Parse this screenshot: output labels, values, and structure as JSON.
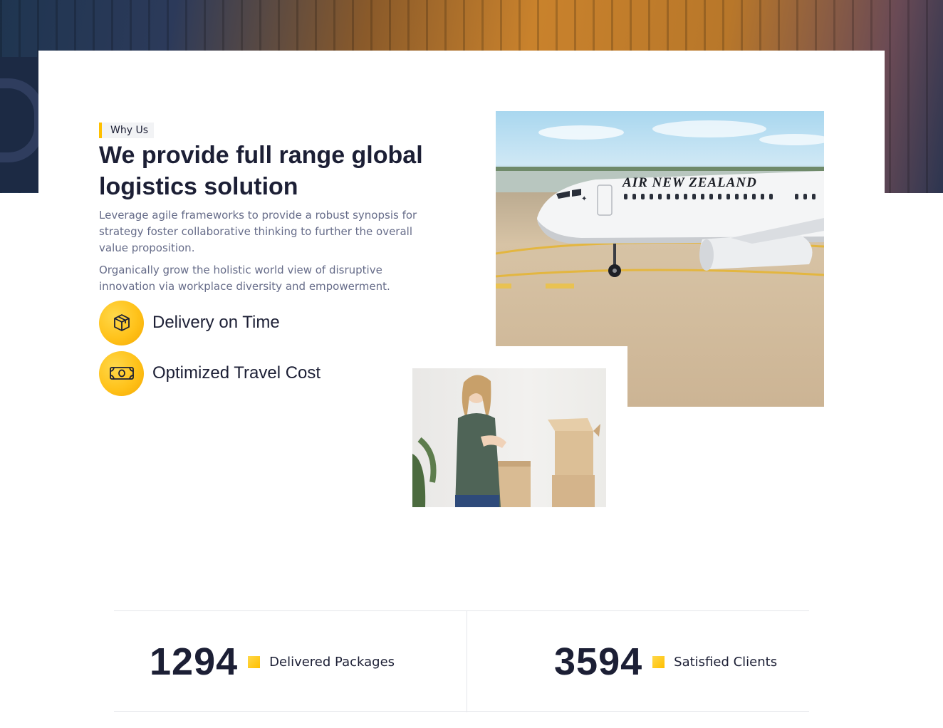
{
  "section": {
    "tag": "Why Us",
    "title": "We provide full range global logistics solution",
    "paragraphs": [
      "Leverage agile frameworks to provide a robust synopsis for strategy foster collaborative thinking to further the overall value proposition.",
      "Organically grow the holistic world view of disruptive innovation via workplace diversity and empowerment."
    ],
    "features": [
      {
        "icon": "package-icon",
        "label": "Delivery on Time"
      },
      {
        "icon": "cash-icon",
        "label": "Optimized Travel Cost"
      }
    ]
  },
  "images": {
    "plane_livery": "AIR NEW ZEALAND"
  },
  "counters": [
    {
      "value": "1294",
      "label": "Delivered Packages"
    },
    {
      "value": "3594",
      "label": "Satisfied Clients"
    }
  ],
  "colors": {
    "accent": "#ffc000",
    "heading": "#1c1f35",
    "body_text": "#666c89"
  }
}
